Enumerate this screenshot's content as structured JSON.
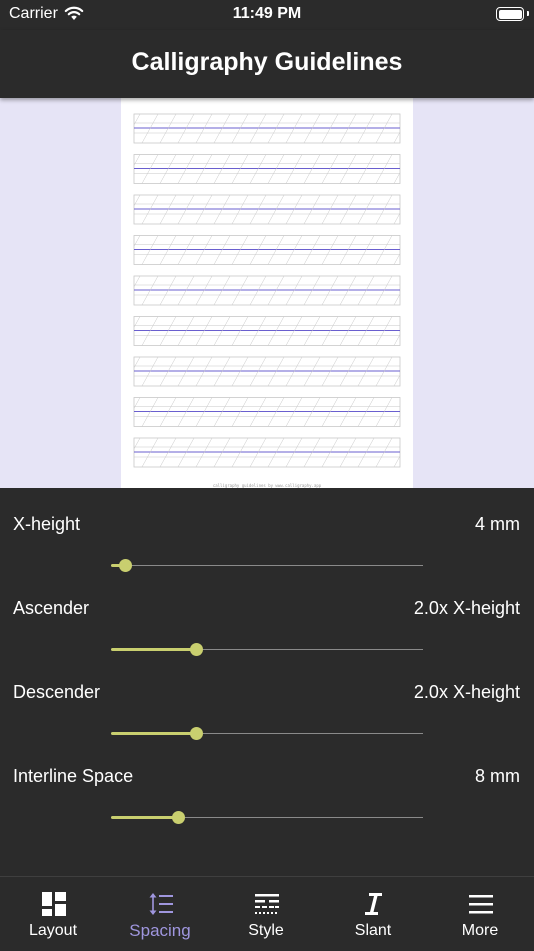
{
  "status": {
    "carrier": "Carrier",
    "time": "11:49 PM"
  },
  "title": "Calligraphy Guidelines",
  "preview": {
    "footer": "calligraphy guidelines by www.calligraphy.app",
    "line_color": "#6a5fcf",
    "guide_color": "#c8c8c8"
  },
  "controls": [
    {
      "label": "X-height",
      "value": "4 mm",
      "fraction": 0.045
    },
    {
      "label": "Ascender",
      "value": "2.0x X-height",
      "fraction": 0.272
    },
    {
      "label": "Descender",
      "value": "2.0x X-height",
      "fraction": 0.272
    },
    {
      "label": "Interline Space",
      "value": "8 mm",
      "fraction": 0.215
    }
  ],
  "tabs": [
    {
      "label": "Layout",
      "icon": "layout-icon"
    },
    {
      "label": "Spacing",
      "icon": "spacing-icon",
      "active": true
    },
    {
      "label": "Style",
      "icon": "style-icon"
    },
    {
      "label": "Slant",
      "icon": "slant-icon"
    },
    {
      "label": "More",
      "icon": "more-icon"
    }
  ],
  "colors": {
    "accent": "#9f96de",
    "slider": "#c9cf6f",
    "background": "#2b2b2b",
    "preview_bg": "#e6e4f6"
  }
}
